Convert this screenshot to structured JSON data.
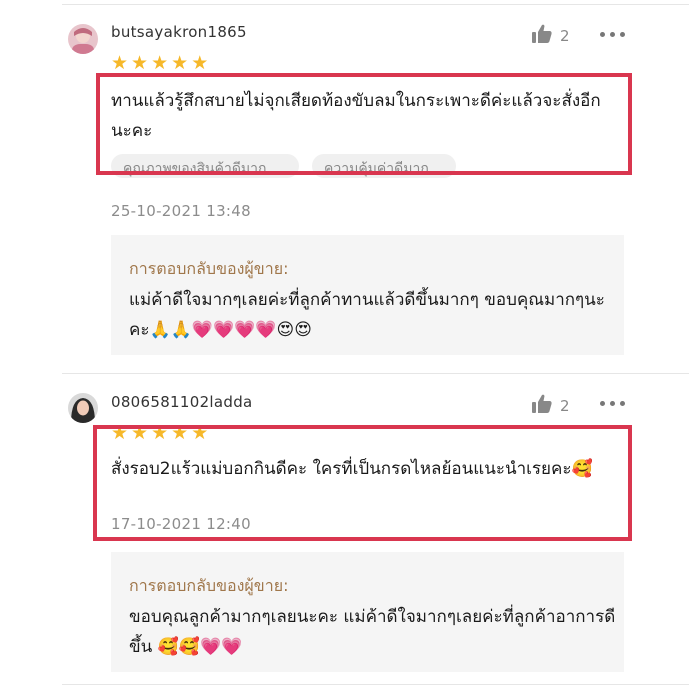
{
  "reviews": [
    {
      "username": "butsayakron1865",
      "likes": "2",
      "rating": 5,
      "comment": "ทานแล้วรู้สึกสบายไม่จุกเสียดท้องขับลมในกระเพาะดีค่ะแล้วจะสั่งอีกนะคะ",
      "tags": [
        "คุณภาพของสินค้าดีมาก",
        "ความคุ้มค่าดีมาก"
      ],
      "date": "25-10-2021 13:48",
      "seller_reply_title": "การตอบกลับของผู้ขาย:",
      "seller_reply": "แม่ค้าดีใจมากๆเลยค่ะที่ลูกค้าทานแล้วดีขึ้นมากๆ ขอบคุณมากๆนะคะ🙏🙏💗💗💗💗😍😍"
    },
    {
      "username": "0806581102ladda",
      "likes": "2",
      "rating": 5,
      "comment": "สั่งรอบ2แร้วแม่บอกกินดีคะ ใครที่เป็นกรดไหลย้อนแนะนำเรยคะ🥰",
      "date": "17-10-2021 12:40",
      "seller_reply_title": "การตอบกลับของผู้ขาย:",
      "seller_reply": "ขอบคุณลูกค้ามากๆเลยนะคะ แม่ค้าดีใจมากๆเลยค่ะที่ลูกค้าอาการดีขึ้น 🥰🥰💗💗"
    }
  ],
  "colors": {
    "star": "#f6b829",
    "highlight": "#d9364f",
    "seller_title": "#a0774b",
    "meta": "#8c8c8c"
  },
  "icons": {
    "like": "thumbs-up-icon",
    "more": "more-dots-icon",
    "star": "star-icon"
  }
}
